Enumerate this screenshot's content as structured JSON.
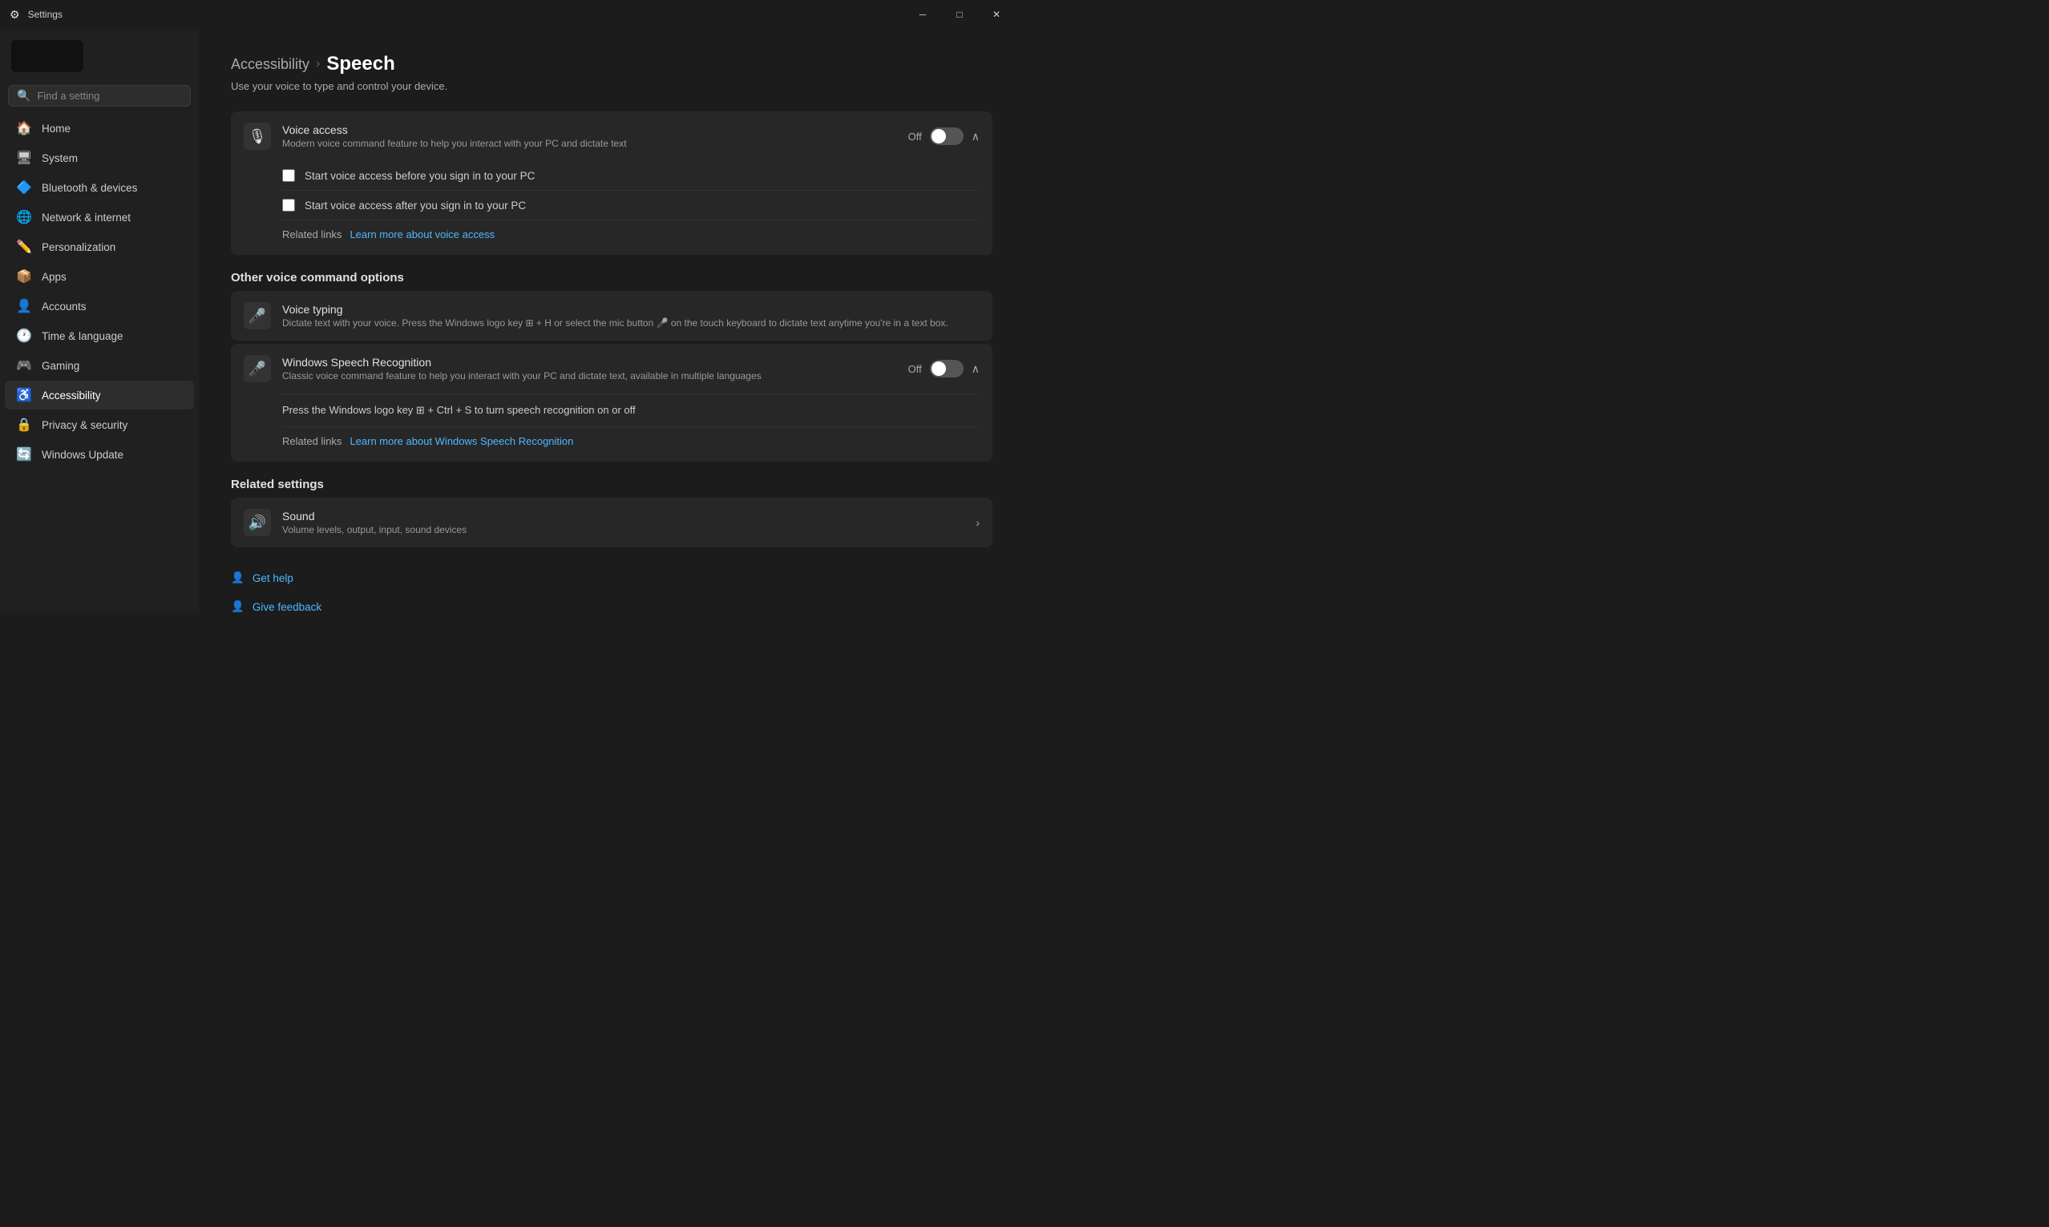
{
  "titleBar": {
    "title": "Settings",
    "minBtn": "─",
    "maxBtn": "□",
    "closeBtn": "✕"
  },
  "sidebar": {
    "searchPlaceholder": "Find a setting",
    "navItems": [
      {
        "id": "home",
        "label": "Home",
        "icon": "🏠"
      },
      {
        "id": "system",
        "label": "System",
        "icon": "🖥"
      },
      {
        "id": "bluetooth",
        "label": "Bluetooth & devices",
        "icon": "🔷"
      },
      {
        "id": "network",
        "label": "Network & internet",
        "icon": "🌐"
      },
      {
        "id": "personalization",
        "label": "Personalization",
        "icon": "✏️"
      },
      {
        "id": "apps",
        "label": "Apps",
        "icon": "📦"
      },
      {
        "id": "accounts",
        "label": "Accounts",
        "icon": "👤"
      },
      {
        "id": "time",
        "label": "Time & language",
        "icon": "🕐"
      },
      {
        "id": "gaming",
        "label": "Gaming",
        "icon": "🎮"
      },
      {
        "id": "accessibility",
        "label": "Accessibility",
        "icon": "♿"
      },
      {
        "id": "privacy",
        "label": "Privacy & security",
        "icon": "🔒"
      },
      {
        "id": "update",
        "label": "Windows Update",
        "icon": "🔄"
      }
    ]
  },
  "page": {
    "breadcrumbParent": "Accessibility",
    "breadcrumbSep": "›",
    "breadcrumbCurrent": "Speech",
    "subtitle": "Use your voice to type and control your device.",
    "voiceAccess": {
      "icon": "🎙",
      "title": "Voice access",
      "desc": "Modern voice command feature to help you interact with your PC and dictate text",
      "toggleLabel": "Off",
      "toggleState": false,
      "checkboxes": [
        {
          "label": "Start voice access before you sign in to your PC",
          "checked": false
        },
        {
          "label": "Start voice access after you sign in to your PC",
          "checked": false
        }
      ],
      "relatedLinksLabel": "Related links",
      "relatedLink": "Learn more about voice access"
    },
    "otherVoiceSection": "Other voice command options",
    "voiceTyping": {
      "icon": "🎤",
      "title": "Voice typing",
      "desc": "Dictate text with your voice. Press the Windows logo key ⊞ + H or select the mic button 🎤 on the touch keyboard to dictate text anytime you're in a text box."
    },
    "windowsSpeech": {
      "icon": "🎤",
      "title": "Windows Speech Recognition",
      "desc": "Classic voice command feature to help you interact with your PC and dictate text, available in multiple languages",
      "toggleLabel": "Off",
      "toggleState": false,
      "infoText": "Press the Windows logo key ⊞ + Ctrl + S to turn speech recognition on or off",
      "relatedLinksLabel": "Related links",
      "relatedLink": "Learn more about Windows Speech Recognition"
    },
    "relatedSettings": "Related settings",
    "sound": {
      "icon": "🔊",
      "title": "Sound",
      "desc": "Volume levels, output, input, sound devices"
    },
    "getHelp": "Get help",
    "giveFeedback": "Give feedback"
  }
}
